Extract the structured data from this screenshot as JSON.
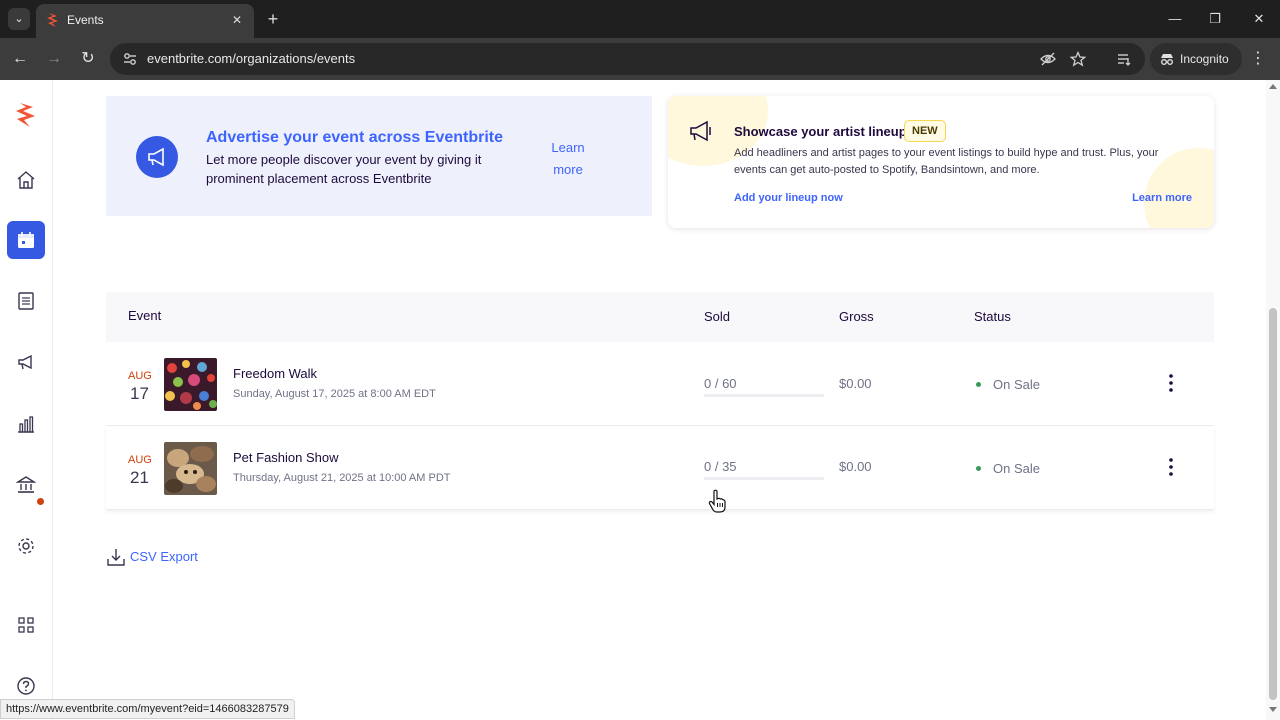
{
  "browser": {
    "tab_title": "Events",
    "url": "eventbrite.com/organizations/events",
    "incognito_label": "Incognito",
    "status_url": "https://www.eventbrite.com/myevent?eid=1466083287579"
  },
  "sidebar": {
    "items": [
      "home",
      "events",
      "orders",
      "marketing",
      "reporting",
      "finance",
      "settings",
      "apps",
      "help"
    ],
    "active": "events"
  },
  "promos": {
    "advertise": {
      "title": "Advertise your event across Eventbrite",
      "description": "Let more people discover your event by giving it prominent placement across Eventbrite",
      "learn_more": "Learn more"
    },
    "lineup": {
      "title": "Showcase your artist lineup",
      "badge": "NEW",
      "description": "Add headliners and artist pages to your event listings to build hype and trust. Plus, your events can get auto-posted to Spotify, Bandsintown, and more.",
      "cta": "Add your lineup now",
      "learn_more": "Learn more"
    }
  },
  "table": {
    "headers": {
      "event": "Event",
      "sold": "Sold",
      "gross": "Gross",
      "status": "Status"
    },
    "rows": [
      {
        "month": "AUG",
        "day": "17",
        "name": "Freedom Walk",
        "date": "Sunday, August 17, 2025 at 8:00 AM EDT",
        "sold": "0 / 60",
        "sold_fraction": 0,
        "gross": "$0.00",
        "status": "On Sale"
      },
      {
        "month": "AUG",
        "day": "21",
        "name": "Pet Fashion Show",
        "date": "Thursday, August 21, 2025 at 10:00 AM PDT",
        "sold": "0 / 35",
        "sold_fraction": 0,
        "gross": "$0.00",
        "status": "On Sale"
      }
    ]
  },
  "csv_export": "CSV Export",
  "colors": {
    "brand": "#d1410c",
    "accent": "#3659e3",
    "link": "#3d64ff",
    "on_sale": "#3a9a5b"
  }
}
